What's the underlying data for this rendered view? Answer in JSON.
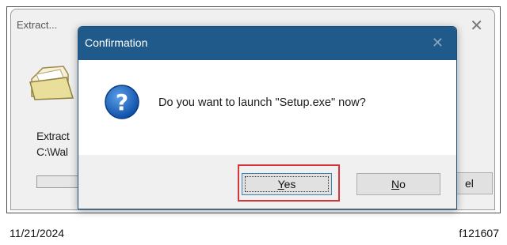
{
  "background_window": {
    "title": "Extract...",
    "close_glyph": "✕",
    "line1": "Extract",
    "line2": "C:\\Wal",
    "cancel_label": "el",
    "folder_icon": "folder-icon"
  },
  "dialog": {
    "title": "Confirmation",
    "close_glyph": "✕",
    "message": "Do you want to launch \"Setup.exe\" now?",
    "icon": "question-icon",
    "yes_accel": "Y",
    "yes_rest": "es",
    "no_accel": "N",
    "no_rest": "o"
  },
  "caption": {
    "date": "11/21/2024",
    "reference": "f121607"
  },
  "colors": {
    "title_bar": "#1f5a8a",
    "highlight": "#d9343a",
    "question_icon": "#1565c0"
  }
}
